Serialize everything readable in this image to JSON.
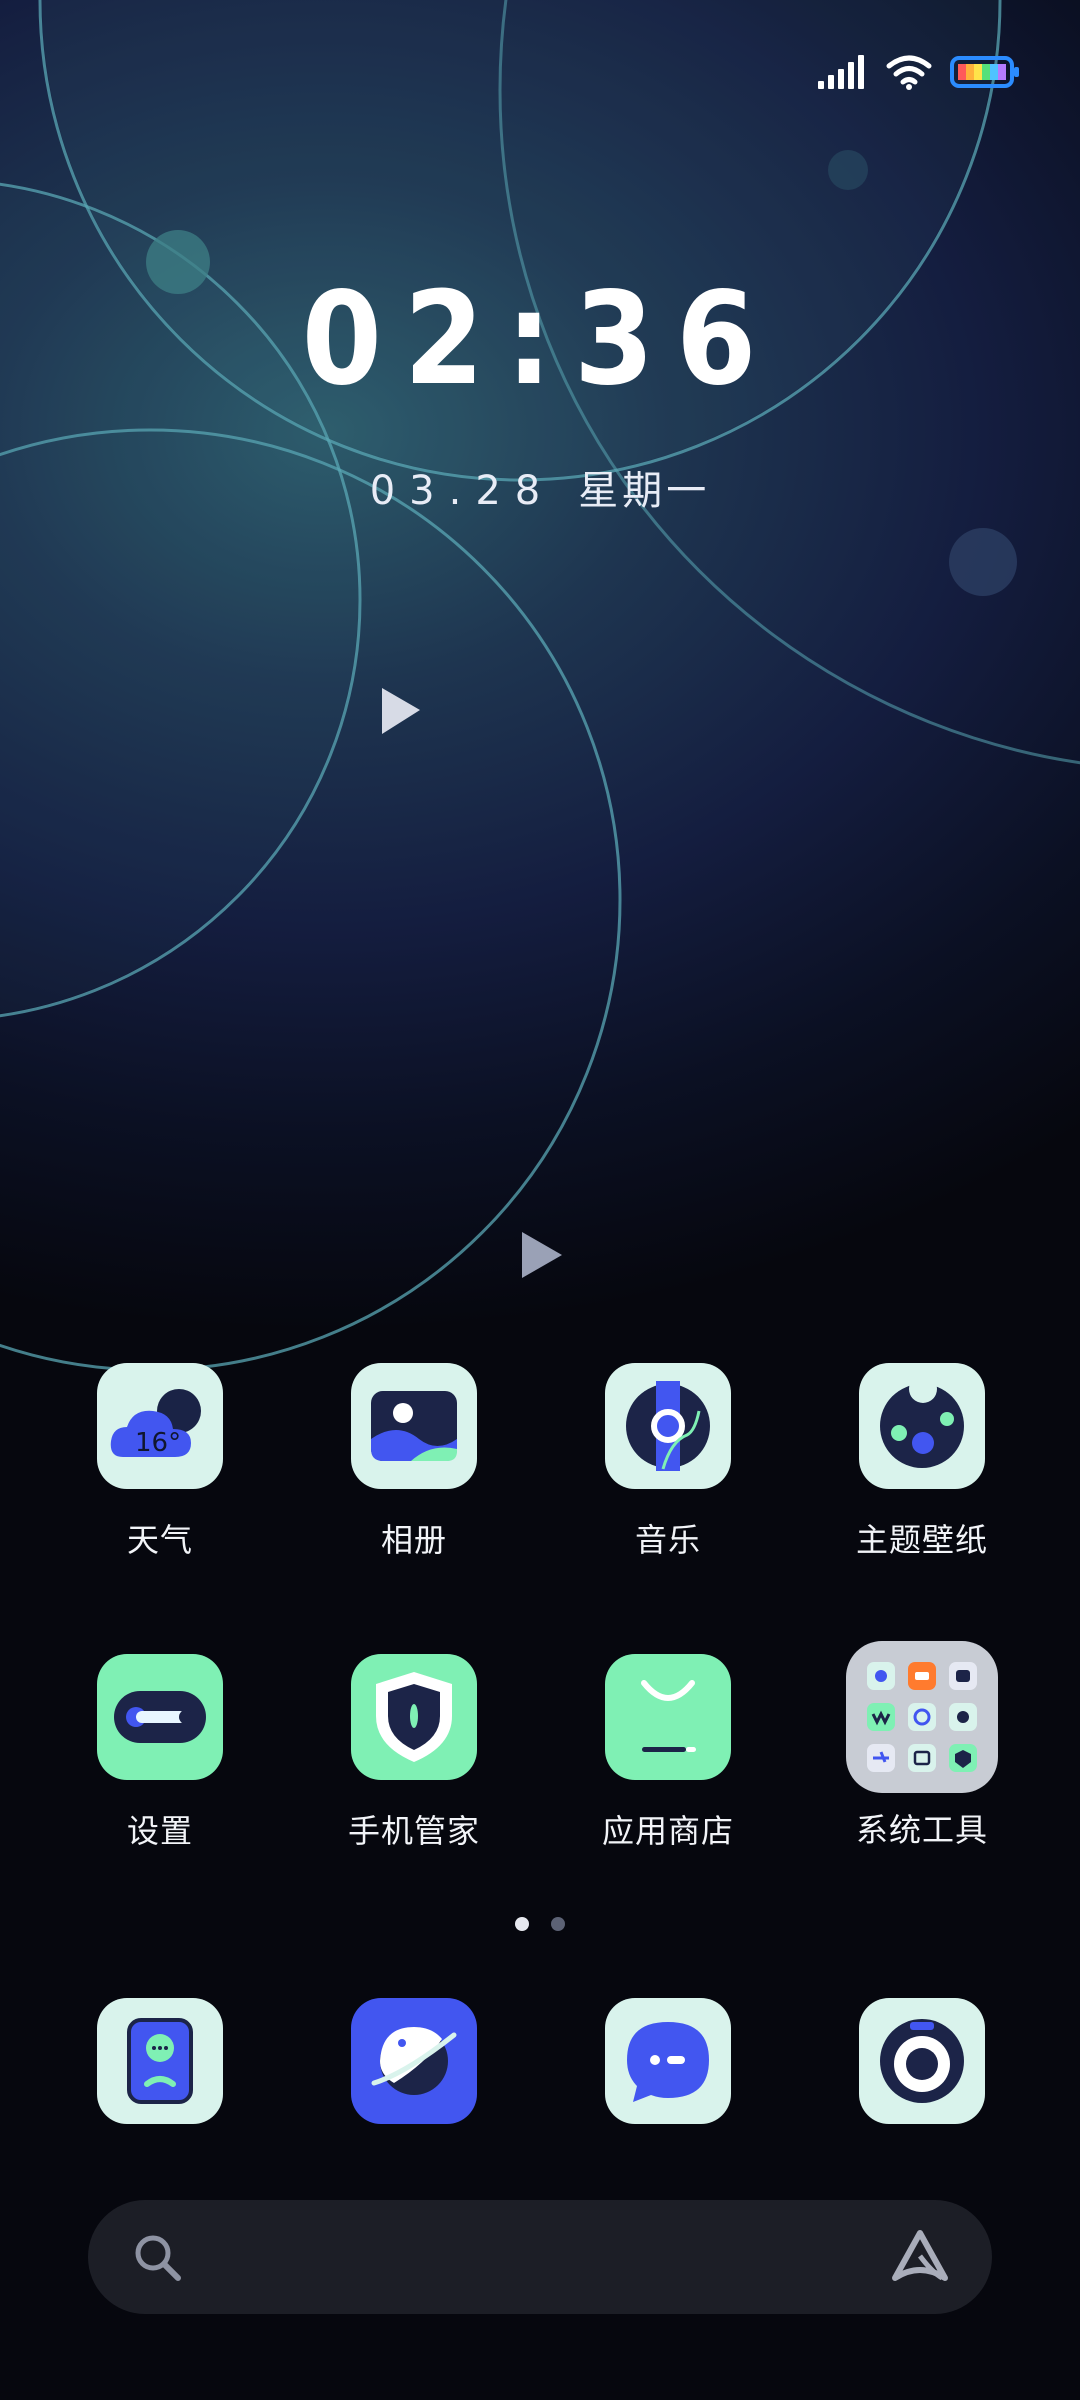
{
  "status_bar": {
    "signal": "signal-icon",
    "wifi": "wifi-icon",
    "battery": "battery-icon"
  },
  "lockscreen": {
    "time": "02:36",
    "date": "03.28",
    "weekday": "星期一"
  },
  "apps_row1": [
    {
      "label": "天气",
      "icon": "weather-icon",
      "temp": "16°"
    },
    {
      "label": "相册",
      "icon": "gallery-icon"
    },
    {
      "label": "音乐",
      "icon": "music-icon"
    },
    {
      "label": "主题壁纸",
      "icon": "theme-wallpaper-icon"
    }
  ],
  "apps_row2": [
    {
      "label": "设置",
      "icon": "settings-toggle-icon"
    },
    {
      "label": "手机管家",
      "icon": "phone-manager-shield-icon"
    },
    {
      "label": "应用商店",
      "icon": "app-store-bag-icon"
    },
    {
      "label": "系统工具",
      "icon": "system-tools-folder-icon"
    }
  ],
  "dock": [
    {
      "icon": "phone-icon"
    },
    {
      "icon": "browser-planet-icon"
    },
    {
      "icon": "messages-icon"
    },
    {
      "icon": "camera-icon"
    }
  ],
  "page_indicator": {
    "pages": 2,
    "active": 1
  },
  "search": {
    "placeholder": ""
  },
  "colors": {
    "mint": "#d9f3ec",
    "green": "#7ff0b4",
    "blue": "#4256f0",
    "navy": "#1c2448"
  }
}
